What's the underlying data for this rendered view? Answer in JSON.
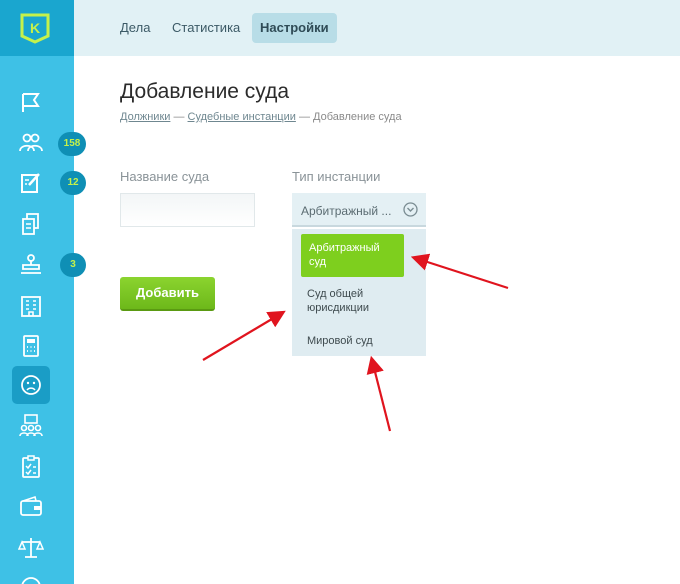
{
  "nav_tabs": [
    {
      "label": "Дела"
    },
    {
      "label": "Статистика"
    },
    {
      "label": "Настройки"
    }
  ],
  "sidebar": {
    "logo_letter": "K",
    "badges": {
      "debtors": "158",
      "tasks": "12",
      "court": "3"
    },
    "icons": [
      "flag-icon",
      "people-icon",
      "edit-icon",
      "documents-icon",
      "stamp-icon",
      "building-icon",
      "calculator-icon",
      "sad-face-icon",
      "group-icon",
      "checklist-icon",
      "wallet-icon",
      "scales-icon"
    ]
  },
  "page": {
    "title": "Добавление суда",
    "breadcrumb": {
      "item1": "Должники",
      "sep": "—",
      "item2": "Судебные инстанции",
      "current": "Добавление суда"
    }
  },
  "form": {
    "name_label": "Название суда",
    "type_label": "Тип инстанции",
    "type_value": "Арбитражный ...",
    "options": [
      "Арбитражный суд",
      "Суд общей юрисдикции",
      "Мировой суд"
    ],
    "submit": "Добавить"
  },
  "colors": {
    "sidebar": "#3ec1e6",
    "accent_green": "#7ecf1e",
    "arrow": "#e0141e"
  }
}
